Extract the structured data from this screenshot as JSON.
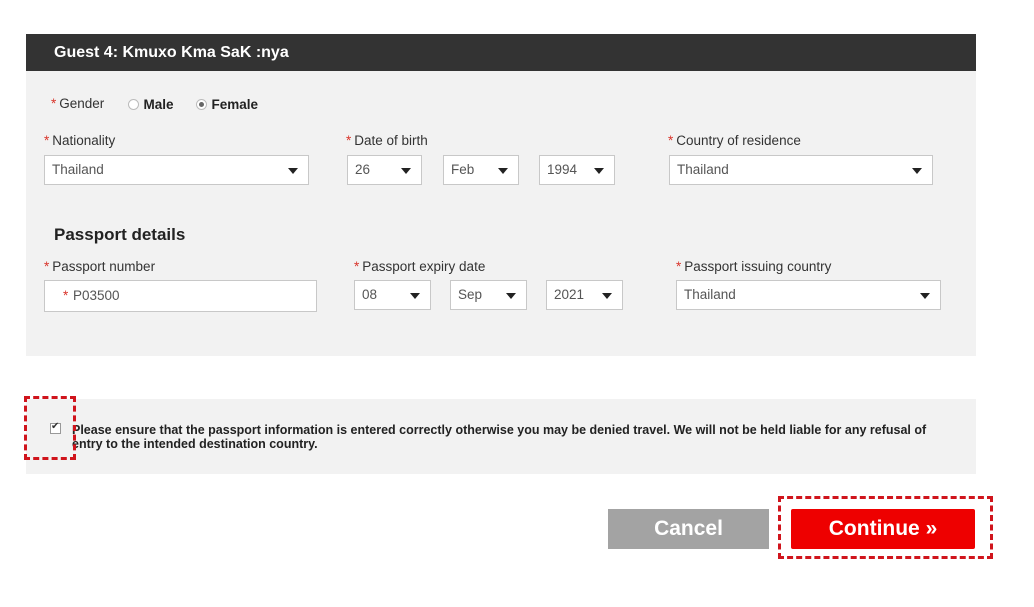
{
  "guest": {
    "header": "Guest 4: Kmuxo Kma  SaK :nya"
  },
  "gender": {
    "label": "Gender",
    "options": [
      {
        "label": "Male",
        "selected": false
      },
      {
        "label": "Female",
        "selected": true
      }
    ]
  },
  "nationality": {
    "label": "Nationality",
    "value": "Thailand"
  },
  "dob": {
    "label": "Date of birth",
    "day": "26",
    "month": "Feb",
    "year": "1994"
  },
  "residence": {
    "label": "Country of residence",
    "value": "Thailand"
  },
  "passport": {
    "section_title": "Passport details",
    "number_label": "Passport number",
    "number_value": "P03500",
    "expiry_label": "Passport expiry date",
    "expiry_day": "08",
    "expiry_month": "Sep",
    "expiry_year": "2021",
    "issuing_label": "Passport issuing country",
    "issuing_value": "Thailand"
  },
  "notice": {
    "checked": true,
    "text": "Please ensure that the passport information is entered correctly otherwise you may be denied travel. We will not be held liable for any refusal of entry to the intended destination country."
  },
  "actions": {
    "cancel_label": "Cancel",
    "continue_label": "Continue »"
  },
  "colors": {
    "header_bg": "#333333",
    "panel_bg": "#f2f2f2",
    "required": "#d9342b",
    "continue_bg": "#ee0000",
    "cancel_bg": "#a3a3a3",
    "highlight": "#d0141c"
  }
}
